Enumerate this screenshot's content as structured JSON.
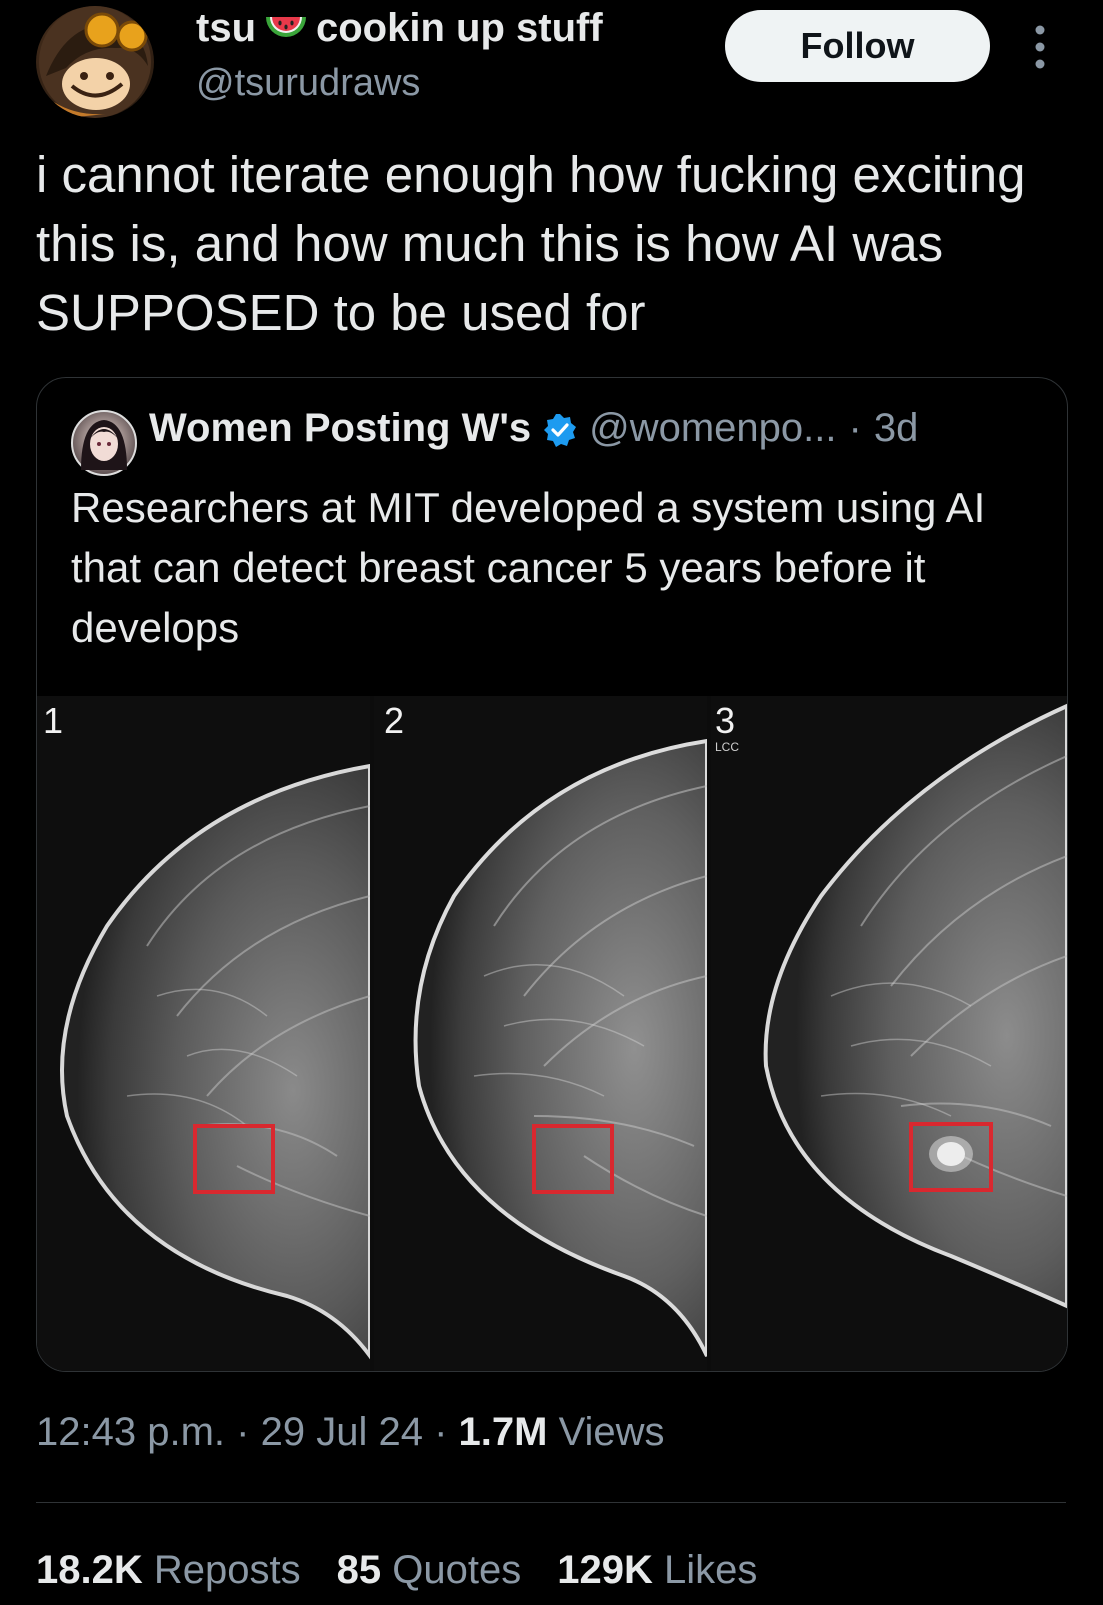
{
  "author": {
    "name": "tsu",
    "name_suffix": "cookin up stuff",
    "emoji": "watermelon-icon",
    "handle": "@tsurudraws"
  },
  "follow_label": "Follow",
  "tweet_text": "i cannot iterate enough how fucking exciting this is, and how much this is how AI was SUPPOSED to be used for",
  "quote": {
    "name": "Women Posting W's",
    "handle": "@womenpo...",
    "separator": "·",
    "age": "3d",
    "text": "Researchers at MIT developed a system using AI that can detect breast cancer 5 years before it develops",
    "image_labels": [
      "1",
      "2",
      "3"
    ],
    "image3_tag": "LCC"
  },
  "meta": {
    "time": "12:43 p.m.",
    "sep1": "·",
    "date": "29 Jul 24",
    "sep2": "·",
    "views_count": "1.7M",
    "views_label": "Views"
  },
  "stats": {
    "reposts_count": "18.2K",
    "reposts_label": "Reposts",
    "quotes_count": "85",
    "quotes_label": "Quotes",
    "likes_count": "129K",
    "likes_label": "Likes"
  },
  "colors": {
    "background": "#000000",
    "text_primary": "#e7e9ea",
    "text_secondary": "#8b98a5",
    "verified": "#1d9bf0",
    "highlight_box": "#d9282f"
  }
}
